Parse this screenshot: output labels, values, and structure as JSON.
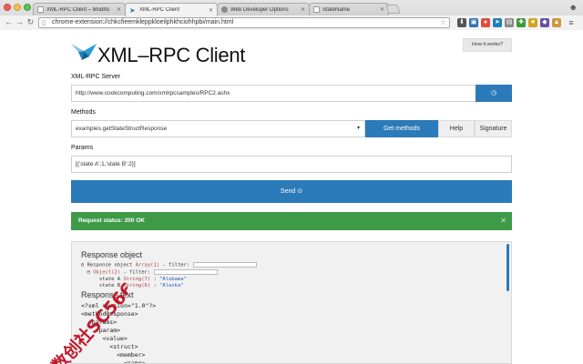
{
  "browser": {
    "tabs": [
      {
        "title": "XML-RPC Client – Modific",
        "active": false
      },
      {
        "title": "XML-RPC Client",
        "active": true
      },
      {
        "title": "Web Developer Options",
        "active": false
      },
      {
        "title": "StateName",
        "active": false
      }
    ],
    "url": "chrome-extension://chkcfieemkleppkloeilphkhciohhpbi/main.html"
  },
  "header": {
    "title": "XML–RPC Client",
    "how_it_works": "How it works?"
  },
  "server": {
    "label": "XML-RPC Server",
    "value": "http://www.cookcomputing.com/xmlrpcsamples/RPC2.ashx"
  },
  "methods": {
    "label": "Methods",
    "selected": "examples.getStateStructResponse",
    "get_methods": "Get methods",
    "help": "Help",
    "signature": "Signature"
  },
  "params": {
    "label": "Params",
    "value": "[{'state A':1,'state B':2}]"
  },
  "send": {
    "label": "Send"
  },
  "status": {
    "text": "Request status: 200 OK"
  },
  "response": {
    "object_heading": "Response object",
    "object_lines": [
      {
        "prefix": "⊟ Response object ",
        "type": "Array(1)",
        "suffix": " - filter: "
      },
      {
        "prefix": "  ⊟ ",
        "type": "Object(2)",
        "suffix": " - filter: "
      },
      {
        "prefix": "      state A ",
        "type": "String(7)",
        "suffix": " : ",
        "value": "\"Alabama\""
      },
      {
        "prefix": "      state B ",
        "type": "String(6)",
        "suffix": " : ",
        "value": "\"Alaska\""
      }
    ],
    "text_heading": "Response text",
    "text": "<?xml version=\"1.0\"?>\n<methodResponse>\n  <params>\n    <param>\n      <value>\n        <struct>\n          <member>\n            <name>\n             state A"
  },
  "watermark": {
    "text": "数创社SC566"
  },
  "colors": {
    "primary": "#2b7ab9",
    "success": "#3e9a47",
    "watermark": "#c0192b"
  }
}
